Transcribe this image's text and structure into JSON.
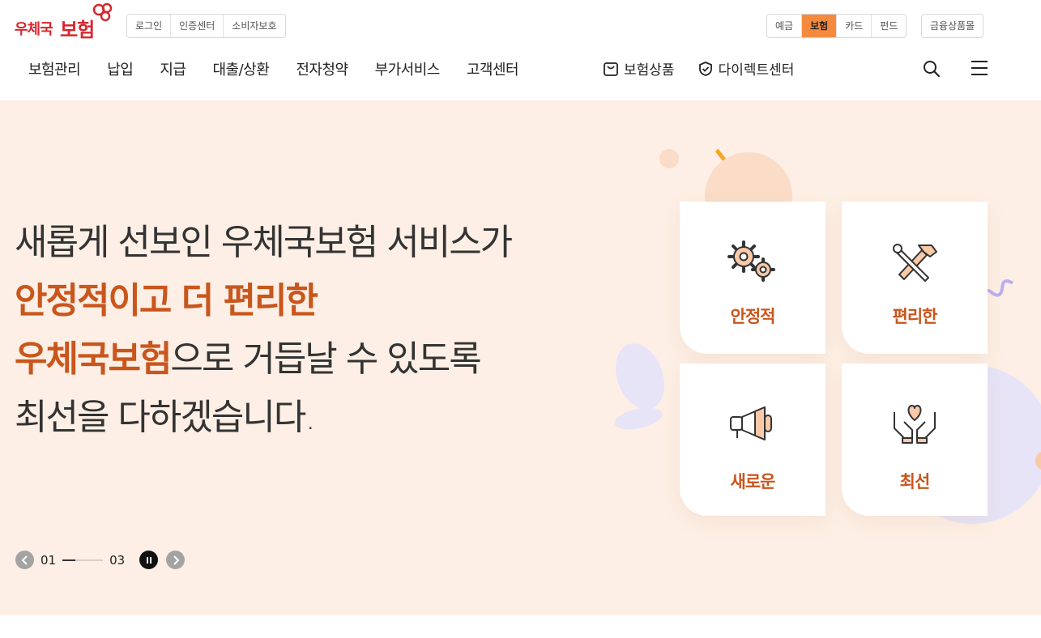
{
  "header": {
    "logo_small": "우체국",
    "logo_big": "보험",
    "util_links": [
      "로그인",
      "인증센터",
      "소비자보호"
    ],
    "site_tabs": [
      {
        "label": "예금",
        "active": false
      },
      {
        "label": "보험",
        "active": true
      },
      {
        "label": "카드",
        "active": false
      },
      {
        "label": "펀드",
        "active": false
      }
    ],
    "mall_label": "금융상품몰",
    "gnb": [
      "보험관리",
      "납입",
      "지급",
      "대출/상환",
      "전자청약",
      "부가서비스",
      "고객센터"
    ],
    "gnb_special": [
      {
        "label": "보험상품",
        "icon": "shopping-bag-icon"
      },
      {
        "label": "다이렉트센터",
        "icon": "shield-check-icon"
      }
    ]
  },
  "hero": {
    "line1": "새롭게 선보인 우체국보험 서비스가",
    "line2": "안정적이고 더 편리한",
    "line3_highlight": "우체국보험",
    "line3_rest": "으로 거듭날 수 있도록",
    "line4": "최선을 다하겠습니다.",
    "pager": {
      "current": "01",
      "total": "03"
    },
    "cards": [
      {
        "label": "안정적",
        "icon": "gears-icon"
      },
      {
        "label": "편리한",
        "icon": "tools-icon"
      },
      {
        "label": "새로운",
        "icon": "megaphone-icon"
      },
      {
        "label": "최선",
        "icon": "heart-hands-icon"
      }
    ]
  },
  "colors": {
    "accent": "#c9561c",
    "hero_bg": "#fdefe5",
    "active_tab": "#f58a3e",
    "brand_red": "#d7262d"
  }
}
